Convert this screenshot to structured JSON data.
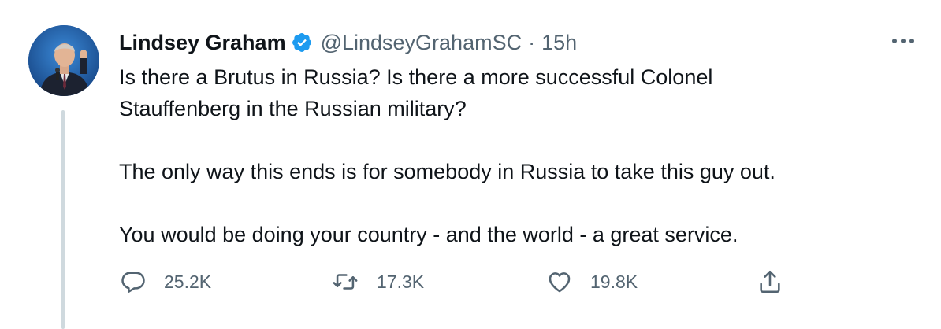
{
  "author": {
    "name": "Lindsey Graham",
    "handle": "@LindseyGrahamSC",
    "separator": "·",
    "time": "15h"
  },
  "tweet": {
    "lines": [
      "Is there a Brutus in Russia?  Is there a more successful Colonel",
      "Stauffenberg in the Russian military?",
      "The only way this ends is for somebody in Russia to take this guy out.",
      "You would be doing your country - and the world - a great service."
    ]
  },
  "actions": {
    "reply_count": "25.2K",
    "retweet_count": "17.3K",
    "like_count": "19.8K"
  },
  "icons": {
    "verified": "verified-badge-icon",
    "more": "more-options-icon",
    "reply": "reply-icon",
    "retweet": "retweet-icon",
    "like": "heart-icon",
    "share": "share-icon"
  },
  "colors": {
    "verified": "#1d9bf0",
    "muted": "#536471",
    "text": "#0f1419",
    "thread_line": "#cfd9de"
  }
}
